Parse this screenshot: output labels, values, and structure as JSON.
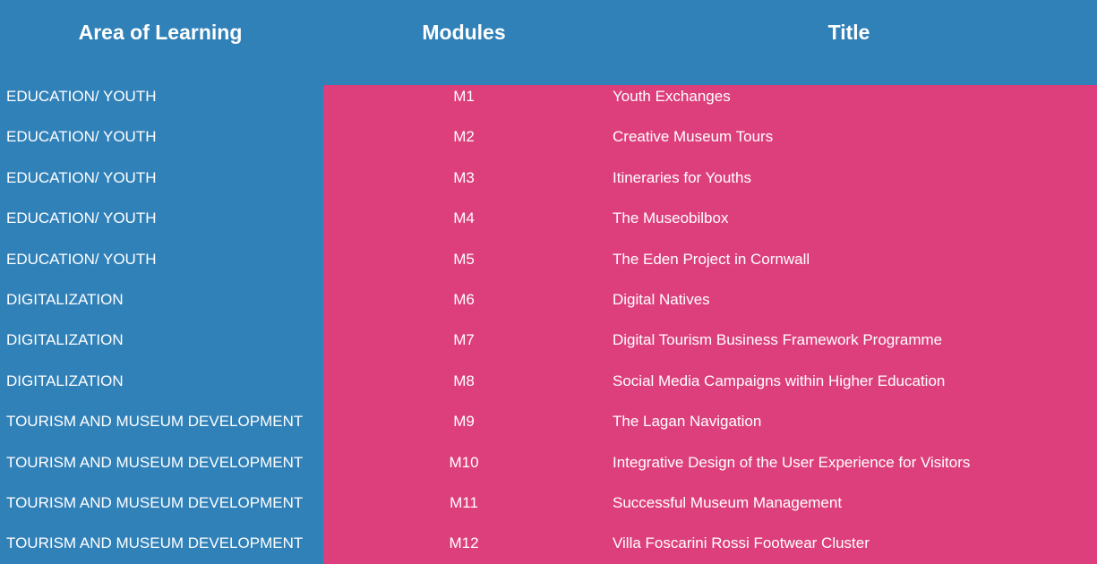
{
  "header": {
    "area": "Area of Learning",
    "modules": "Modules",
    "title": "Title"
  },
  "colors": {
    "blue": "#3181b9",
    "pink": "#dd3f7c",
    "text": "#ffffff"
  },
  "rows": [
    {
      "area": "EDUCATION/ YOUTH",
      "module": "M1",
      "title": "Youth Exchanges"
    },
    {
      "area": "EDUCATION/ YOUTH",
      "module": "M2",
      "title": "Creative Museum Tours"
    },
    {
      "area": "EDUCATION/ YOUTH",
      "module": "M3",
      "title": "Itineraries for Youths"
    },
    {
      "area": "EDUCATION/ YOUTH",
      "module": "M4",
      "title": "The Museobilbox"
    },
    {
      "area": "EDUCATION/ YOUTH",
      "module": "M5",
      "title": "The Eden Project in Cornwall"
    },
    {
      "area": "DIGITALIZATION",
      "module": "M6",
      "title": "Digital Natives"
    },
    {
      "area": "DIGITALIZATION",
      "module": "M7",
      "title": "Digital Tourism Business Framework Programme"
    },
    {
      "area": "DIGITALIZATION",
      "module": "M8",
      "title": "Social Media Campaigns within Higher Education"
    },
    {
      "area": "TOURISM AND MUSEUM DEVELOPMENT",
      "module": "M9",
      "title": "The Lagan Navigation"
    },
    {
      "area": "TOURISM AND MUSEUM DEVELOPMENT",
      "module": "M10",
      "title": "Integrative Design of the User Experience for Visitors"
    },
    {
      "area": "TOURISM AND MUSEUM DEVELOPMENT",
      "module": "M11",
      "title": "Successful Museum Management"
    },
    {
      "area": "TOURISM AND MUSEUM DEVELOPMENT",
      "module": "M12",
      "title": "Villa Foscarini Rossi Footwear Cluster"
    }
  ]
}
